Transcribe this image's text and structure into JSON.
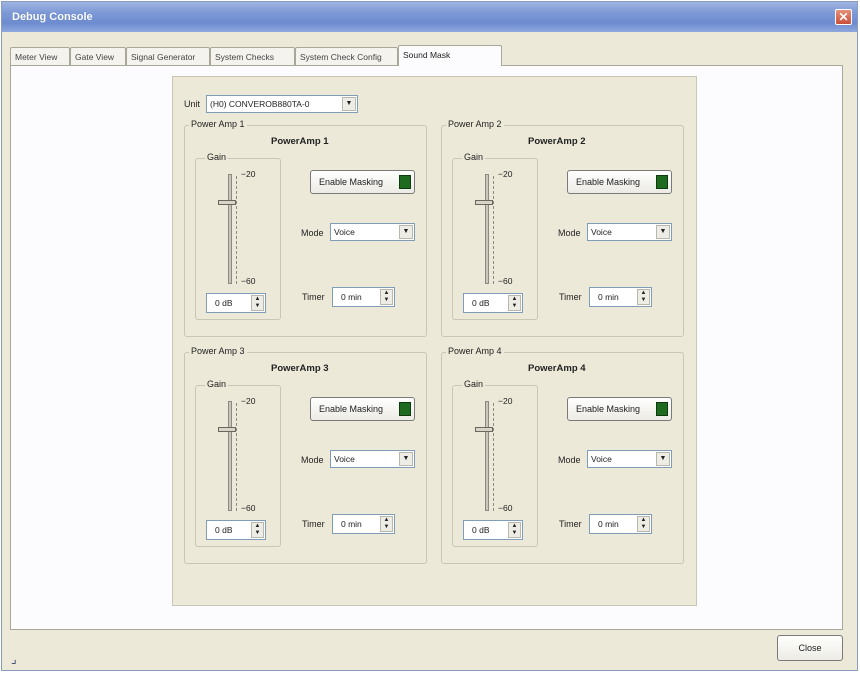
{
  "window": {
    "title": "Debug Console",
    "close_glyph": "✕"
  },
  "tabs": [
    "Meter View",
    "Gate View",
    "Signal Generator",
    "System Checks",
    "System Check Config",
    "Sound Mask"
  ],
  "active_tab": 5,
  "unit": {
    "label": "Unit",
    "value": "(H0) CONVEROB880TA-0"
  },
  "amps": [
    {
      "group": "Power Amp 1",
      "heading": "PowerAmp 1",
      "gain_label": "Gain",
      "tick_top": "−20",
      "tick_bottom": "−60",
      "gain_value": "0 dB",
      "enable_label": "Enable Masking",
      "mode_label": "Mode",
      "mode_value": "Voice",
      "timer_label": "Timer",
      "timer_value": "0 min"
    },
    {
      "group": "Power Amp 2",
      "heading": "PowerAmp 2",
      "gain_label": "Gain",
      "tick_top": "−20",
      "tick_bottom": "−60",
      "gain_value": "0 dB",
      "enable_label": "Enable Masking",
      "mode_label": "Mode",
      "mode_value": "Voice",
      "timer_label": "Timer",
      "timer_value": "0 min"
    },
    {
      "group": "Power Amp 3",
      "heading": "PowerAmp 3",
      "gain_label": "Gain",
      "tick_top": "−20",
      "tick_bottom": "−60",
      "gain_value": "0 dB",
      "enable_label": "Enable Masking",
      "mode_label": "Mode",
      "mode_value": "Voice",
      "timer_label": "Timer",
      "timer_value": "0 min"
    },
    {
      "group": "Power Amp 4",
      "heading": "PowerAmp 4",
      "gain_label": "Gain",
      "tick_top": "−20",
      "tick_bottom": "−60",
      "gain_value": "0 dB",
      "enable_label": "Enable Masking",
      "mode_label": "Mode",
      "mode_value": "Voice",
      "timer_label": "Timer",
      "timer_value": "0 min"
    }
  ],
  "footer": {
    "close_label": "Close"
  },
  "colors": {
    "led_on": "#1e6a1e",
    "title_bar": "#7e9ad6"
  }
}
